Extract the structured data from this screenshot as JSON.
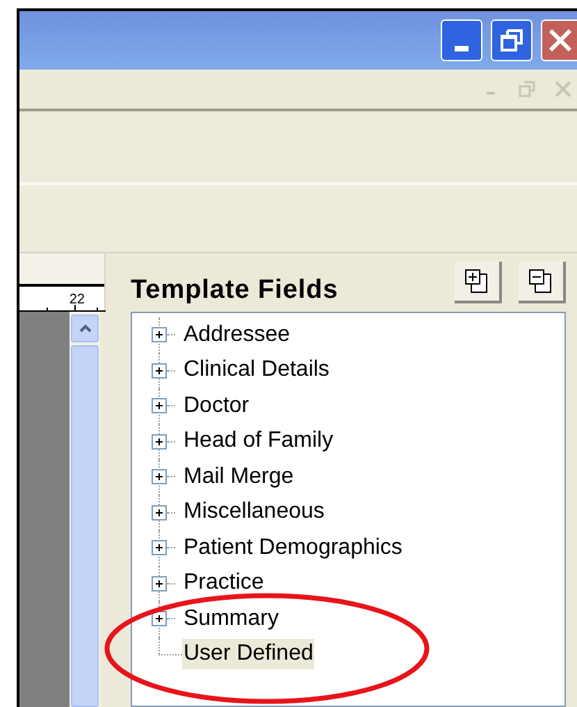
{
  "ruler": {
    "label": "22"
  },
  "panel": {
    "title": "Template Fields"
  },
  "tree": {
    "items": [
      {
        "label": "Addressee",
        "expandable": true,
        "selected": false
      },
      {
        "label": "Clinical Details",
        "expandable": true,
        "selected": false
      },
      {
        "label": "Doctor",
        "expandable": true,
        "selected": false
      },
      {
        "label": "Head of Family",
        "expandable": true,
        "selected": false
      },
      {
        "label": "Mail Merge",
        "expandable": true,
        "selected": false
      },
      {
        "label": "Miscellaneous",
        "expandable": true,
        "selected": false
      },
      {
        "label": "Patient Demographics",
        "expandable": true,
        "selected": false
      },
      {
        "label": "Practice",
        "expandable": true,
        "selected": false
      },
      {
        "label": "Summary",
        "expandable": true,
        "selected": false
      },
      {
        "label": "User Defined",
        "expandable": false,
        "selected": true
      }
    ]
  }
}
